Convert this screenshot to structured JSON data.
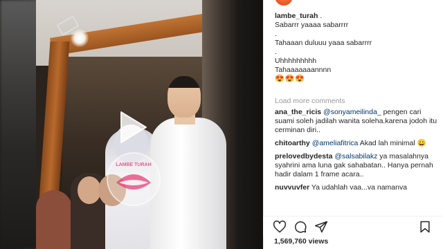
{
  "post": {
    "username": "lambe_turah",
    "username_suffix": " .",
    "caption_lines": [
      "Sabarrr yaaaa sabarrrr",
      ".",
      "Tahaaan duluuu yaaa sabarrrr",
      ".",
      "Uhhhhhhhhh",
      "Tahaaaaaaannnn"
    ],
    "caption_emoji": "😍😍😍"
  },
  "load_more_label": "Load more comments",
  "comments": [
    {
      "user": "ana_the_ricis",
      "mention": "@sonyameilinda_",
      "text": " pengen cari suami soleh jadilah wanita soleha.karena jodoh itu cerminan diri.."
    },
    {
      "user": "chitoarthy",
      "mention": "@ameliafitrica",
      "text": " Akad lah minimal 😀"
    },
    {
      "user": "prelovedbydesta",
      "mention": "@salsabilakz",
      "text": " ya masalahnya syahrini ama luna gak sahabatan.. Hanya pernah hadir dalam 1 frame acara.."
    },
    {
      "user": "nuvvuvfer",
      "mention": "",
      "text": " Ya udahlah vaa...va namanva"
    }
  ],
  "views": "1,569,760 views",
  "watermark_text": "LAMBE TURAH",
  "colors": {
    "mention": "#003569",
    "muted": "#999999",
    "text": "#262626"
  },
  "icons": [
    "play-icon",
    "heart-icon",
    "comment-icon",
    "share-icon",
    "bookmark-icon"
  ]
}
